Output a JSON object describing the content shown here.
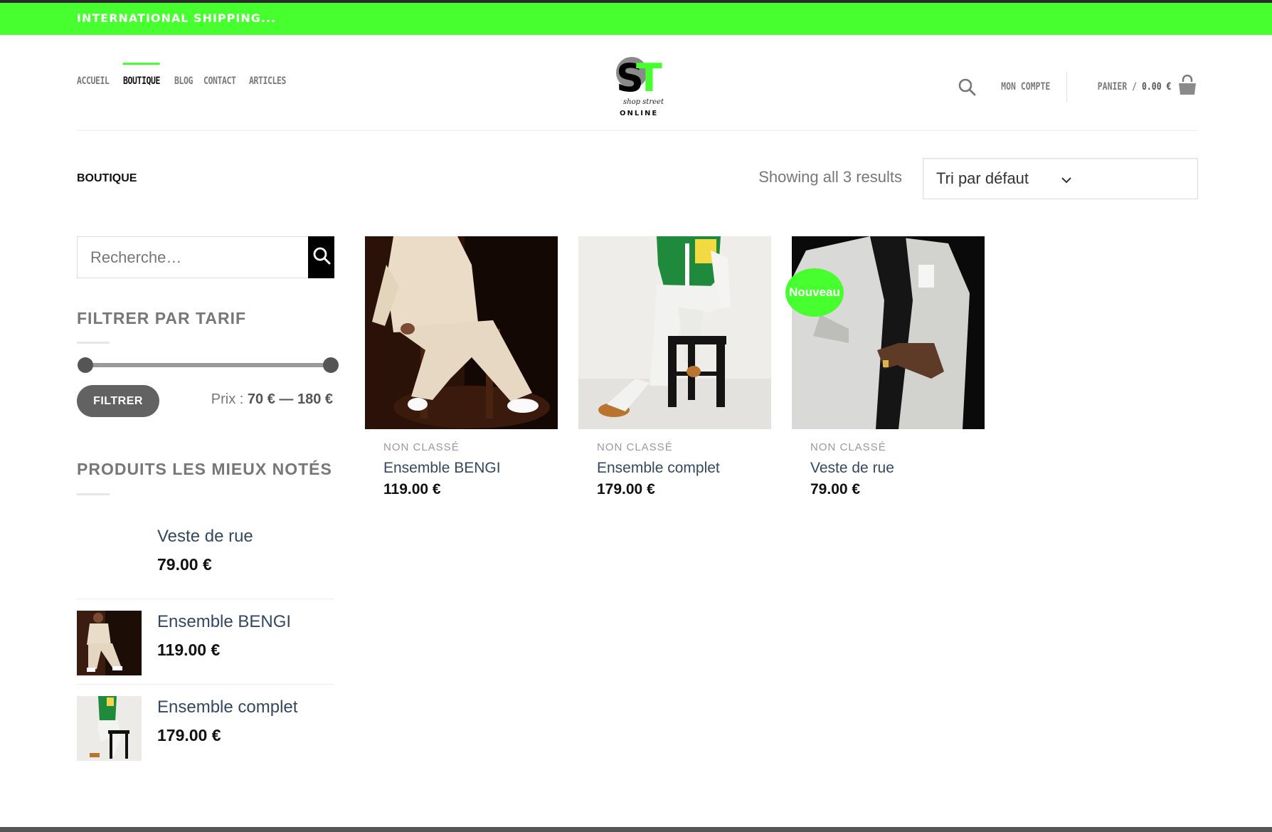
{
  "topbar": {
    "text": "INTERNATIONAL SHIPPING..."
  },
  "nav": {
    "items": [
      {
        "label": "ACCUEIL"
      },
      {
        "label": "BOUTIQUE",
        "active": true
      },
      {
        "label": "BLOG"
      },
      {
        "label": "CONTACT"
      },
      {
        "label": "ARTICLES"
      }
    ]
  },
  "logo": {
    "letters": "ST",
    "script": "shop street",
    "sub": "ONLINE"
  },
  "header_right": {
    "account": "MON COMPTE",
    "cart_label": "PANIER /",
    "cart_total": "0.00 €"
  },
  "breadcrumb": "BOUTIQUE",
  "results_text": "Showing all 3 results",
  "sort": {
    "selected": "Tri par défaut"
  },
  "search": {
    "placeholder": "Recherche…"
  },
  "price_filter": {
    "title": "FILTRER PAR TARIF",
    "button": "FILTRER",
    "prefix": "Prix :",
    "range": "70 € — 180 €"
  },
  "top_rated": {
    "title": "PRODUITS LES MIEUX NOTÉS",
    "items": [
      {
        "name": "Veste de rue",
        "price": "79.00 €"
      },
      {
        "name": "Ensemble BENGI",
        "price": "119.00 €"
      },
      {
        "name": "Ensemble complet",
        "price": "179.00 €"
      }
    ]
  },
  "products": [
    {
      "category": "NON CLASSÉ",
      "name": "Ensemble BENGI",
      "price": "119.00 €"
    },
    {
      "category": "NON CLASSÉ",
      "name": "Ensemble complet",
      "price": "179.00 €"
    },
    {
      "category": "NON CLASSÉ",
      "name": "Veste de rue",
      "price": "79.00 €",
      "badge": "Nouveau"
    }
  ],
  "colors": {
    "accent": "#47ff2e",
    "link": "#334862",
    "dark": "#000000"
  }
}
